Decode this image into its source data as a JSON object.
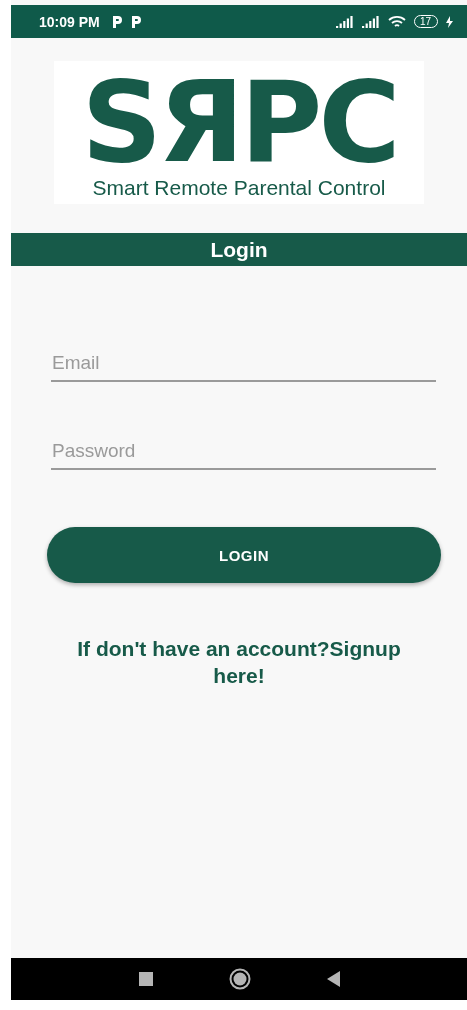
{
  "status_bar": {
    "time": "10:09 PM",
    "battery": "17"
  },
  "logo": {
    "mark": "SЯPC",
    "tagline": "Smart Remote Parental Control"
  },
  "header": {
    "title": "Login"
  },
  "fields": [
    {
      "placeholder": "Email"
    },
    {
      "placeholder": "Password"
    }
  ],
  "login_button": "LOGIN",
  "signup_link": "If don't have an account?Signup here!"
}
